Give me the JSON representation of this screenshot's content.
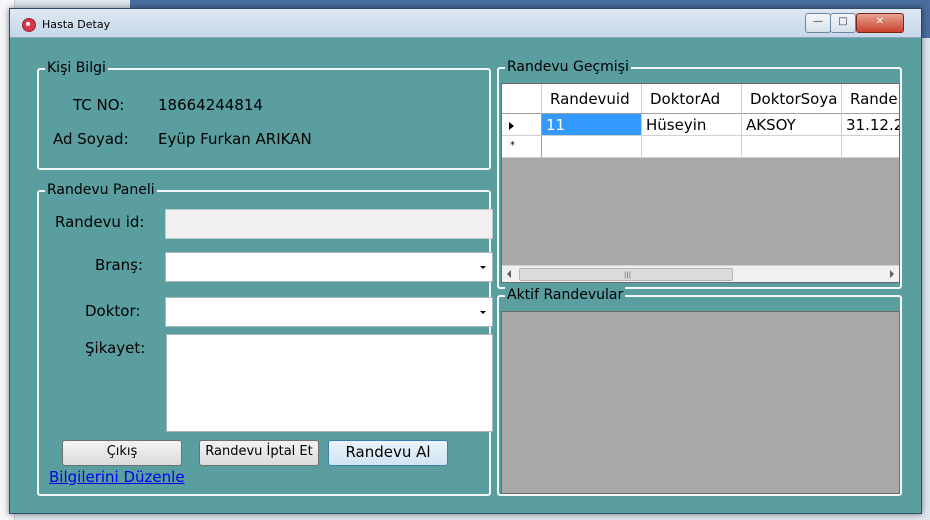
{
  "window": {
    "title": "Hasta Detay"
  },
  "kisi_bilgi": {
    "title": "Kişi Bilgi",
    "tc_label": "TC NO:",
    "tc_value": "18664244814",
    "name_label": "Ad Soyad:",
    "name_value": "Eyüp Furkan ARIKAN"
  },
  "randevu_paneli": {
    "title": "Randevu Paneli",
    "id_label": "Randevu id:",
    "id_value": "",
    "brans_label": "Branş:",
    "brans_value": "",
    "doktor_label": "Doktor:",
    "doktor_value": "",
    "sikayet_label": "Şikayet:",
    "sikayet_value": "",
    "cikis_label": "Çıkış",
    "iptal_label": "Randevu İptal Et",
    "al_label": "Randevu Al",
    "duzenle_link": "Bilgilerini Düzenle"
  },
  "randevu_gecmisi": {
    "title": "Randevu Geçmişi",
    "columns": [
      "Randevuid",
      "DoktorAd",
      "DoktorSoya",
      "Rande"
    ],
    "rows": [
      [
        "11",
        "Hüseyin",
        "AKSOY",
        "31.12.2"
      ]
    ]
  },
  "aktif_randevular": {
    "title": "Aktif Randevular"
  },
  "colors": {
    "form_background": "#5b9ea0",
    "selection": "#3399ff"
  }
}
